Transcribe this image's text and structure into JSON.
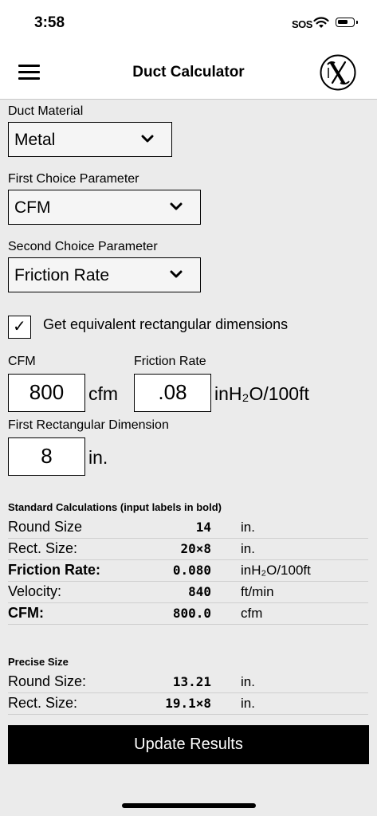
{
  "status": {
    "time": "3:58",
    "sos": "SOS"
  },
  "nav": {
    "title": "Duct Calculator"
  },
  "form": {
    "material_label": "Duct Material",
    "material_value": "Metal",
    "first_param_label": "First Choice Parameter",
    "first_param_value": "CFM",
    "second_param_label": "Second Choice Parameter",
    "second_param_value": "Friction Rate",
    "equiv_rect_label": "Get equivalent rectangular dimensions",
    "equiv_rect_checked": "✓",
    "cfm_label": "CFM",
    "cfm_value": "800",
    "cfm_unit": "cfm",
    "friction_label": "Friction Rate",
    "friction_value": ".08",
    "friction_unit": "inH₂O/100ft",
    "rect_dim_label": "First Rectangular Dimension",
    "rect_dim_value": "8",
    "rect_dim_unit": "in."
  },
  "standard": {
    "title": "Standard Calculations (input labels in bold)",
    "rows": [
      {
        "name": "Round Size",
        "value": "14",
        "unit": "in."
      },
      {
        "name": "Rect. Size:",
        "value": "20×8",
        "unit": "in."
      },
      {
        "name": "Friction Rate:",
        "value": "0.080",
        "unit": "inH₂O/100ft"
      },
      {
        "name": "Velocity:",
        "value": "840",
        "unit": "ft/min"
      },
      {
        "name": "CFM:",
        "value": "800.0",
        "unit": "cfm"
      }
    ]
  },
  "precise": {
    "title": "Precise Size",
    "rows": [
      {
        "name": "Round Size:",
        "value": "13.21",
        "unit": "in."
      },
      {
        "name": "Rect. Size:",
        "value": "19.1×8",
        "unit": "in."
      }
    ]
  },
  "update_button": "Update Results"
}
